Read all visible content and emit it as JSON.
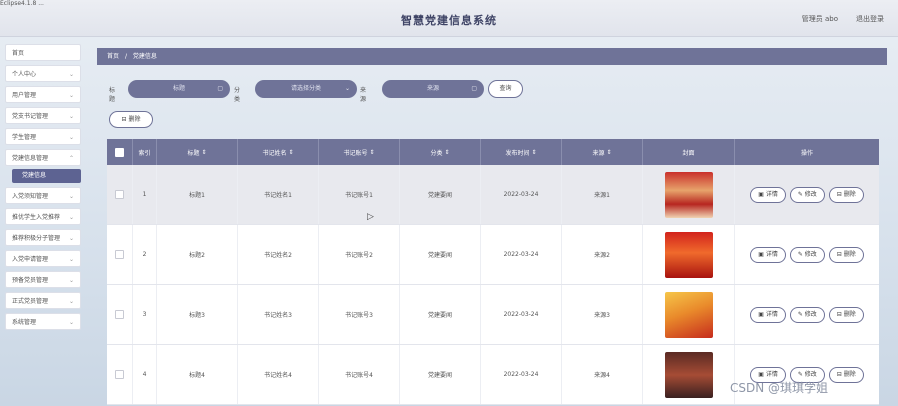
{
  "header": {
    "corner_text": "Eclipse4.1.8 ... ",
    "title": "智慧党建信息系统",
    "user": "管理员 abo",
    "logout": "退出登录"
  },
  "sidebar": {
    "items": [
      {
        "label": "首页",
        "has_chevron": false
      },
      {
        "label": "个人中心",
        "has_chevron": true
      },
      {
        "label": "用户管理",
        "has_chevron": true
      },
      {
        "label": "党支书记管理",
        "has_chevron": true
      },
      {
        "label": "学生管理",
        "has_chevron": true
      },
      {
        "label": "党建信息管理",
        "has_chevron": true
      },
      {
        "label": "入党须知管理",
        "has_chevron": true
      },
      {
        "label": "推优学生入党推荐",
        "has_chevron": true
      },
      {
        "label": "推荐积极分子管理",
        "has_chevron": true
      },
      {
        "label": "入党申请管理",
        "has_chevron": true
      },
      {
        "label": "预备党员管理",
        "has_chevron": true
      },
      {
        "label": "正式党员管理",
        "has_chevron": true
      },
      {
        "label": "系统管理",
        "has_chevron": true
      }
    ],
    "active_sub": "党建信息"
  },
  "breadcrumb": {
    "home": "首页",
    "sep": "/",
    "current": "党建信息"
  },
  "filters": {
    "title_label": "标题",
    "title_placeholder": "标题",
    "category_label": "分类",
    "category_placeholder": "请选择分类",
    "source_label": "来源",
    "source_placeholder": "来源",
    "query_button": "查询"
  },
  "batch_delete": "删除",
  "table": {
    "headers": [
      "索引",
      "标题",
      "书记姓名",
      "书记账号",
      "分类",
      "发布时间",
      "来源",
      "封面",
      "操作"
    ],
    "rows": [
      {
        "index": "1",
        "title": "标题1",
        "sec_name": "书记姓名1",
        "sec_account": "书记账号1",
        "category": "党建要闻",
        "date": "2022-03-24",
        "source": "来源1"
      },
      {
        "index": "2",
        "title": "标题2",
        "sec_name": "书记姓名2",
        "sec_account": "书记账号2",
        "category": "党建要闻",
        "date": "2022-03-24",
        "source": "来源2"
      },
      {
        "index": "3",
        "title": "标题3",
        "sec_name": "书记姓名3",
        "sec_account": "书记账号3",
        "category": "党建要闻",
        "date": "2022-03-24",
        "source": "来源3"
      },
      {
        "index": "4",
        "title": "标题4",
        "sec_name": "书记姓名4",
        "sec_account": "书记账号4",
        "category": "党建要闻",
        "date": "2022-03-24",
        "source": "来源4"
      }
    ],
    "actions": {
      "detail": "详情",
      "edit": "修改",
      "delete": "删除"
    }
  },
  "watermark": "CSDN @琪琪学姐",
  "colors": {
    "accent": "#6f7398",
    "active_sub": "#5d6392"
  }
}
